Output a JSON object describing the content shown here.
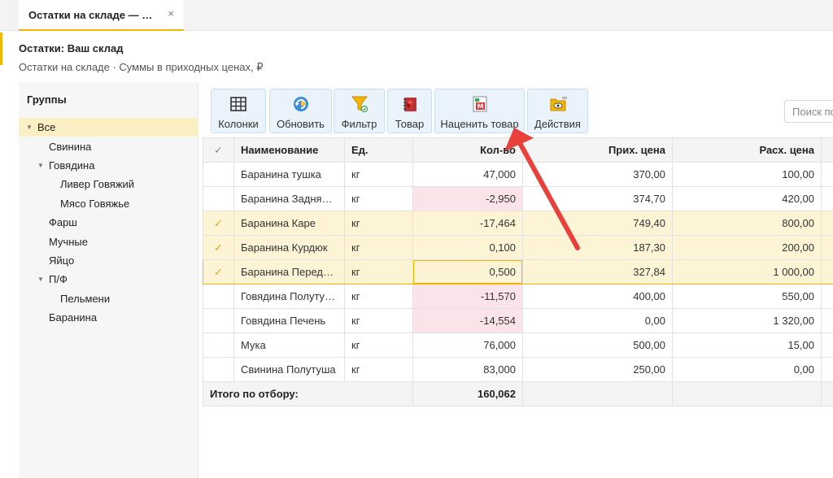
{
  "tab": {
    "title": "Остатки на складе — Ваш склад",
    "close": "×"
  },
  "header": {
    "title": "Остатки: Ваш склад",
    "subtitle": "Остатки на складе · Суммы в приходных ценах, ₽"
  },
  "sidebar": {
    "title": "Группы",
    "items": [
      {
        "label": "Все",
        "level": 0,
        "caret": "▼",
        "selected": true
      },
      {
        "label": "Свинина",
        "level": 1
      },
      {
        "label": "Говядина",
        "level": 1,
        "caret": "▼"
      },
      {
        "label": "Ливер Говяжий",
        "level": 2
      },
      {
        "label": "Мясо Говяжье",
        "level": 2
      },
      {
        "label": "Фарш",
        "level": 1
      },
      {
        "label": "Мучные",
        "level": 1
      },
      {
        "label": "Яйцо",
        "level": 1
      },
      {
        "label": "П/Ф",
        "level": 1,
        "caret": "▼"
      },
      {
        "label": "Пельмени",
        "level": 2
      },
      {
        "label": "Баранина",
        "level": 1
      }
    ]
  },
  "toolbar": {
    "columns": "Колонки",
    "refresh": "Обновить",
    "filter": "Фильтр",
    "product": "Товар",
    "markup": "Наценить товар",
    "actions": "Действия"
  },
  "search": {
    "placeholder": "Поиск по"
  },
  "table": {
    "headers": {
      "check": "✓",
      "name": "Наименование",
      "unit": "Ед.",
      "qty": "Кол-во",
      "in_price": "Прих. цена",
      "out_price": "Расх. цена"
    },
    "rows": [
      {
        "checked": false,
        "check": "",
        "name": "Баранина тушка",
        "unit": "кг",
        "qty": "47,000",
        "in_price": "370,00",
        "out_price": "100,00",
        "negative": false
      },
      {
        "checked": false,
        "check": "",
        "name": "Баранина Задняя часть",
        "unit": "кг",
        "qty": "-2,950",
        "in_price": "374,70",
        "out_price": "420,00",
        "negative": true
      },
      {
        "checked": true,
        "check": "✓",
        "name": "Баранина Каре",
        "unit": "кг",
        "qty": "-17,464",
        "in_price": "749,40",
        "out_price": "800,00",
        "negative": false
      },
      {
        "checked": true,
        "check": "✓",
        "name": "Баранина Курдюк",
        "unit": "кг",
        "qty": "0,100",
        "in_price": "187,30",
        "out_price": "200,00",
        "negative": false
      },
      {
        "checked": true,
        "check": "✓",
        "name": "Баранина Передняя часть",
        "unit": "кг",
        "qty": "0,500",
        "in_price": "327,84",
        "out_price": "1 000,00",
        "negative": false,
        "focused": true
      },
      {
        "checked": false,
        "check": "",
        "name": "Говядина Полутуша",
        "unit": "кг",
        "qty": "-11,570",
        "in_price": "400,00",
        "out_price": "550,00",
        "negative": true
      },
      {
        "checked": false,
        "check": "",
        "name": "Говядина Печень",
        "unit": "кг",
        "qty": "-14,554",
        "in_price": "0,00",
        "out_price": "1 320,00",
        "negative": true
      },
      {
        "checked": false,
        "check": "",
        "name": "Мука",
        "unit": "кг",
        "qty": "76,000",
        "in_price": "500,00",
        "out_price": "15,00",
        "negative": false
      },
      {
        "checked": false,
        "check": "",
        "name": "Свинина Полутуша",
        "unit": "кг",
        "qty": "83,000",
        "in_price": "250,00",
        "out_price": "0,00",
        "negative": false
      }
    ],
    "total": {
      "label": "Итого по отбору:",
      "qty": "160,062"
    }
  },
  "colors": {
    "accent": "#f2b600",
    "arrow": "#e8403a",
    "negative_bg": "#fbe3ea",
    "checked_bg": "#fdf4d6"
  }
}
